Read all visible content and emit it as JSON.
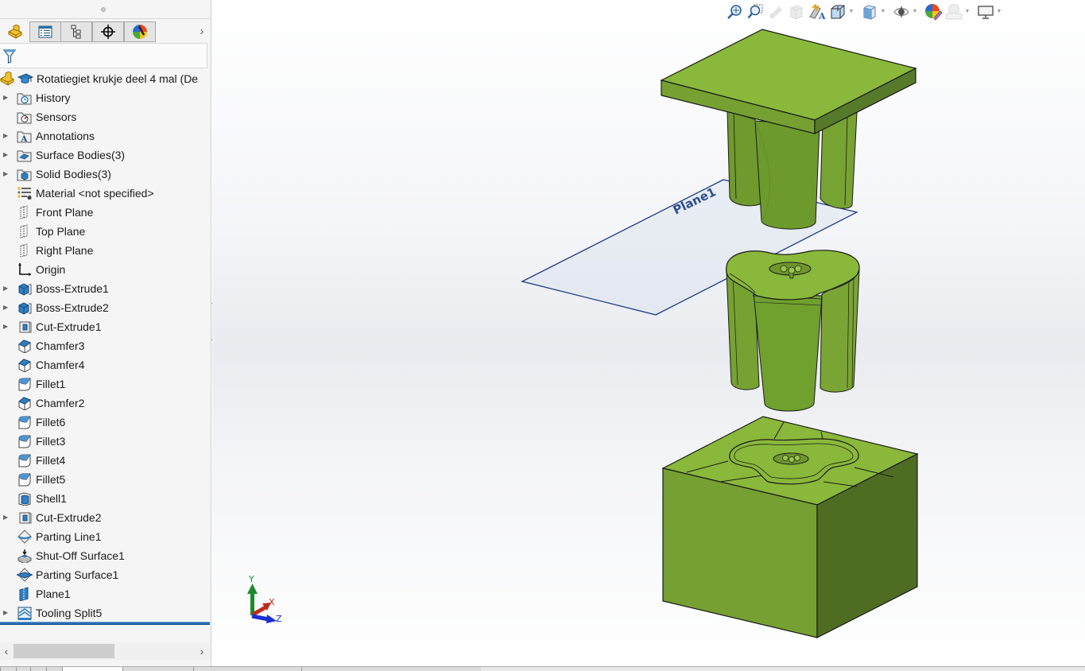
{
  "feature_manager": {
    "tabs": [
      {
        "name": "featuremanager-tab",
        "icon": "part-icon",
        "active": true
      },
      {
        "name": "propertymanager-tab",
        "icon": "property-list-icon",
        "active": false
      },
      {
        "name": "configurationmanager-tab",
        "icon": "configuration-tree-icon",
        "active": false
      },
      {
        "name": "dimxpertmanager-tab",
        "icon": "crosshair-target-icon",
        "active": false
      },
      {
        "name": "displaymanager-tab",
        "icon": "color-wheel-icon",
        "active": false
      }
    ],
    "more_tabs_glyph": "›",
    "filter_icon": "funnel-icon",
    "root": {
      "label": "Rotatiegiet krukje deel 4 mal  (De",
      "icons": [
        "part-icon",
        "graduation-cap-icon"
      ]
    },
    "items": [
      {
        "label": "History",
        "icon": "history-folder-icon",
        "expandable": true
      },
      {
        "label": "Sensors",
        "icon": "sensors-folder-icon",
        "expandable": false
      },
      {
        "label": "Annotations",
        "icon": "annotations-folder-icon",
        "expandable": true
      },
      {
        "label": "Surface Bodies(3)",
        "icon": "surface-bodies-folder-icon",
        "expandable": true
      },
      {
        "label": "Solid Bodies(3)",
        "icon": "solid-bodies-folder-icon",
        "expandable": true
      },
      {
        "label": "Material <not specified>",
        "icon": "material-icon",
        "expandable": false
      },
      {
        "label": "Front Plane",
        "icon": "plane-icon",
        "expandable": false
      },
      {
        "label": "Top Plane",
        "icon": "plane-icon",
        "expandable": false
      },
      {
        "label": "Right Plane",
        "icon": "plane-icon",
        "expandable": false
      },
      {
        "label": "Origin",
        "icon": "origin-icon",
        "expandable": false
      },
      {
        "label": "Boss-Extrude1",
        "icon": "boss-extrude-icon",
        "expandable": true
      },
      {
        "label": "Boss-Extrude2",
        "icon": "boss-extrude-icon",
        "expandable": true
      },
      {
        "label": "Cut-Extrude1",
        "icon": "cut-extrude-icon",
        "expandable": true
      },
      {
        "label": "Chamfer3",
        "icon": "chamfer-icon",
        "expandable": false
      },
      {
        "label": "Chamfer4",
        "icon": "chamfer-icon",
        "expandable": false
      },
      {
        "label": "Fillet1",
        "icon": "fillet-icon",
        "expandable": false
      },
      {
        "label": "Chamfer2",
        "icon": "chamfer-icon",
        "expandable": false
      },
      {
        "label": "Fillet6",
        "icon": "fillet-icon",
        "expandable": false
      },
      {
        "label": "Fillet3",
        "icon": "fillet-icon",
        "expandable": false
      },
      {
        "label": "Fillet4",
        "icon": "fillet-icon",
        "expandable": false
      },
      {
        "label": "Fillet5",
        "icon": "fillet-icon",
        "expandable": false
      },
      {
        "label": "Shell1",
        "icon": "shell-icon",
        "expandable": false
      },
      {
        "label": "Cut-Extrude2",
        "icon": "cut-extrude-icon",
        "expandable": true
      },
      {
        "label": "Parting Line1",
        "icon": "parting-line-icon",
        "expandable": false
      },
      {
        "label": "Shut-Off Surface1",
        "icon": "shut-off-surface-icon",
        "expandable": false
      },
      {
        "label": "Parting Surface1",
        "icon": "parting-surface-icon",
        "expandable": false
      },
      {
        "label": "Plane1",
        "icon": "plane-solid-icon",
        "expandable": false
      },
      {
        "label": "Tooling Split5",
        "icon": "tooling-split-icon",
        "expandable": true
      }
    ],
    "scroll_left": "‹",
    "scroll_right": "›"
  },
  "view_toolbar": {
    "buttons": [
      {
        "name": "zoom-to-fit",
        "icon": "zoom-to-fit-icon",
        "enabled": true,
        "dropdown": false
      },
      {
        "name": "zoom-to-area",
        "icon": "zoom-to-area-icon",
        "enabled": true,
        "dropdown": false
      },
      {
        "name": "previous-view",
        "icon": "previous-view-icon",
        "enabled": false,
        "dropdown": false
      },
      {
        "name": "section-view",
        "icon": "section-view-icon",
        "enabled": false,
        "dropdown": false
      },
      {
        "name": "dynamic-annotation-views",
        "icon": "dynamic-annotation-icon",
        "enabled": true,
        "dropdown": false
      },
      {
        "name": "view-orientation",
        "icon": "view-orientation-icon",
        "enabled": true,
        "dropdown": true
      },
      {
        "name": "display-style",
        "icon": "display-style-icon",
        "enabled": true,
        "dropdown": true
      },
      {
        "name": "hide-show-items",
        "icon": "eye-icon",
        "enabled": true,
        "dropdown": true
      },
      {
        "name": "edit-appearance",
        "icon": "edit-appearance-icon",
        "enabled": true,
        "dropdown": false
      },
      {
        "name": "apply-scene",
        "icon": "apply-scene-icon",
        "enabled": false,
        "dropdown": true
      },
      {
        "name": "view-settings",
        "icon": "monitor-icon",
        "enabled": true,
        "dropdown": true
      }
    ],
    "dropdown_glyph": "▼"
  },
  "scene": {
    "plane_label": "Plane1",
    "body_color": "#8ab83a",
    "body_side_color": "#76a032",
    "body_dark_color": "#4f6d22",
    "plane_edge_color": "#1f3f8a",
    "bodies": [
      "top-mold-half",
      "stool-core",
      "bottom-mold-half"
    ]
  },
  "triad": {
    "x_label": "X",
    "y_label": "Y",
    "z_label": "Z",
    "x_color": "#c0281e",
    "y_color": "#1e8a2e",
    "z_color": "#1a2fd0"
  }
}
